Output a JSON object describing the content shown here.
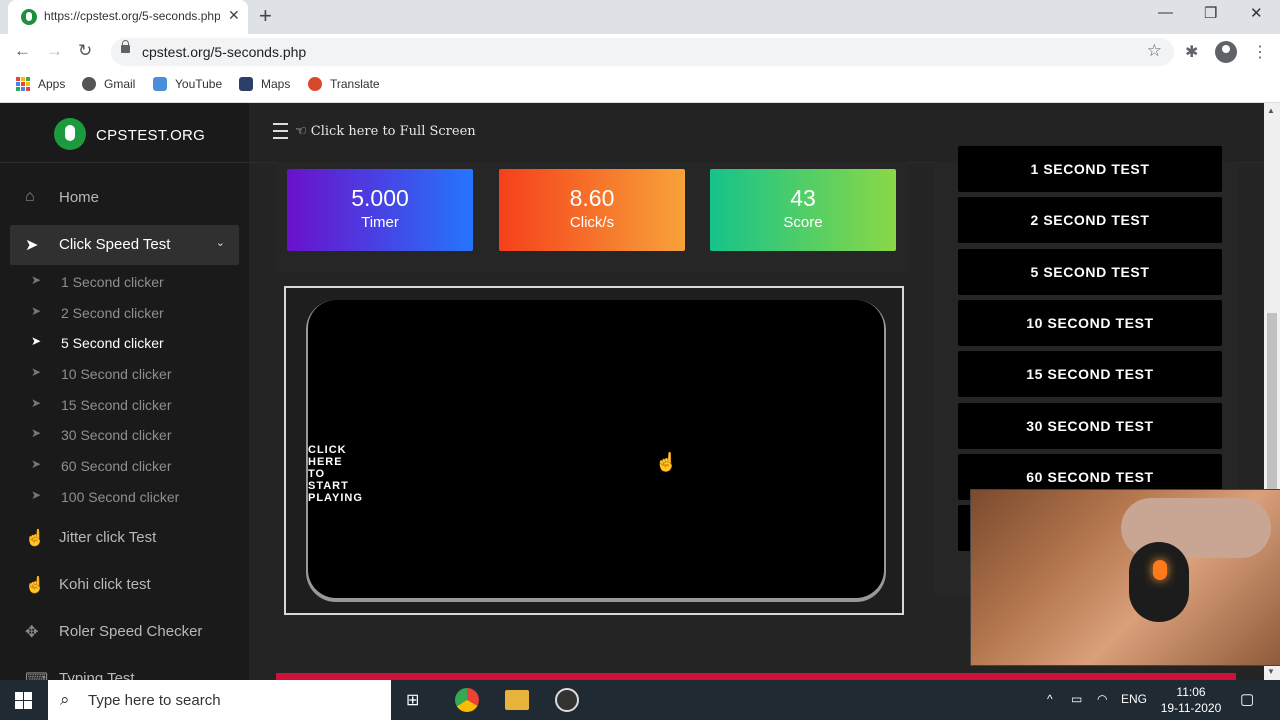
{
  "browser": {
    "tab_title": "https://cpstest.org/5-seconds.php",
    "url": "cpstest.org/5-seconds.php",
    "bookmarks": [
      {
        "label": "Apps",
        "icon": "apps-grid-icon"
      },
      {
        "label": "Gmail",
        "icon": "gmail-icon"
      },
      {
        "label": "YouTube",
        "icon": "youtube-icon"
      },
      {
        "label": "Maps",
        "icon": "maps-icon"
      },
      {
        "label": "Translate",
        "icon": "translate-icon"
      }
    ]
  },
  "site": {
    "brand": "CPSTEST.ORG",
    "fullscreen_label": "Click here to Full Screen",
    "nav": [
      {
        "label": "Home",
        "icon": "home-icon"
      },
      {
        "label": "Click Speed Test",
        "icon": "cursor-icon"
      },
      {
        "label": "Jitter click Test",
        "icon": "hand-pointer-icon"
      },
      {
        "label": "Kohi click test",
        "icon": "hand-pointer-icon"
      },
      {
        "label": "Roler Speed Checker",
        "icon": "move-icon"
      },
      {
        "label": "Typing Test",
        "icon": "keyboard-icon"
      }
    ],
    "subnav": [
      "1 Second clicker",
      "2 Second clicker",
      "5 Second clicker",
      "10 Second clicker",
      "15 Second clicker",
      "30 Second clicker",
      "60 Second clicker",
      "100 Second clicker"
    ]
  },
  "stats": {
    "timer": {
      "value": "5.000",
      "label": "Timer"
    },
    "cps": {
      "value": "8.60",
      "label": "Click/s"
    },
    "score": {
      "value": "43",
      "label": "Score"
    }
  },
  "game": {
    "start_label": "CLICK HERE TO START PLAYING"
  },
  "tests": [
    "1 SECOND TEST",
    "2 SECOND TEST",
    "5 SECOND TEST",
    "10 SECOND TEST",
    "15 SECOND TEST",
    "30 SECOND TEST",
    "60 SECOND TEST"
  ],
  "taskbar": {
    "search_placeholder": "Type here to search",
    "language": "ENG",
    "time": "11:06",
    "date": "19-11-2020"
  }
}
